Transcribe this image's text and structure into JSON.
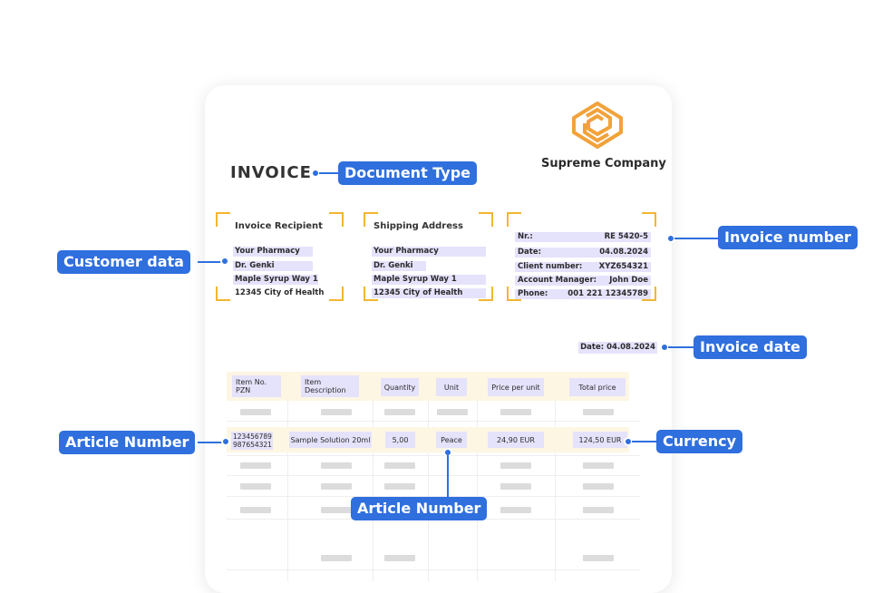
{
  "invoice": {
    "company_name": "Supreme Company",
    "doc_title": "INVOICE",
    "recipient": {
      "title": "Invoice Recipient",
      "lines": [
        "Your Pharmacy",
        "Dr. Genki",
        "Maple Syrup Way 1",
        "12345 City of Health"
      ]
    },
    "shipping": {
      "title": "Shipping Address",
      "lines": [
        "Your Pharmacy",
        "Dr. Genki",
        "Maple Syrup Way 1",
        "12345 City of Health"
      ]
    },
    "meta": [
      {
        "key": "Nr.:",
        "value": "RE 5420-5"
      },
      {
        "key": "Date:",
        "value": "04.08.2024"
      },
      {
        "key": "Client number:",
        "value": "XYZ654321"
      },
      {
        "key": "Account Manager:",
        "value": "John Doe"
      },
      {
        "key": "Phone:",
        "value": "001 221 12345789"
      }
    ],
    "date_chip": "Date: 04.08.2024",
    "table": {
      "headers": [
        "Item No. PZN",
        "Item Description",
        "Quantity",
        "Unit",
        "Price per unit",
        "Total price"
      ],
      "row": {
        "item_no": "123456789",
        "pzn": "987654321",
        "description": "Sample Solution 20ml",
        "quantity": "5,00",
        "unit": "Peace",
        "price": "24,90 EUR",
        "total": "124,50 EUR"
      }
    }
  },
  "callouts": {
    "document_type": "Document Type",
    "customer_data": "Customer data",
    "invoice_number": "Invoice number",
    "invoice_date": "Invoice date",
    "article_number_left": "Article Number",
    "currency": "Currency",
    "article_number_bottom": "Article Number"
  },
  "colors": {
    "callout_blue": "#2f6fde",
    "bracket_yellow": "#f2b630",
    "highlight_lavender": "#e5e2fb",
    "row_cream": "#fdf6e3",
    "logo_orange": "#f2a23a"
  }
}
